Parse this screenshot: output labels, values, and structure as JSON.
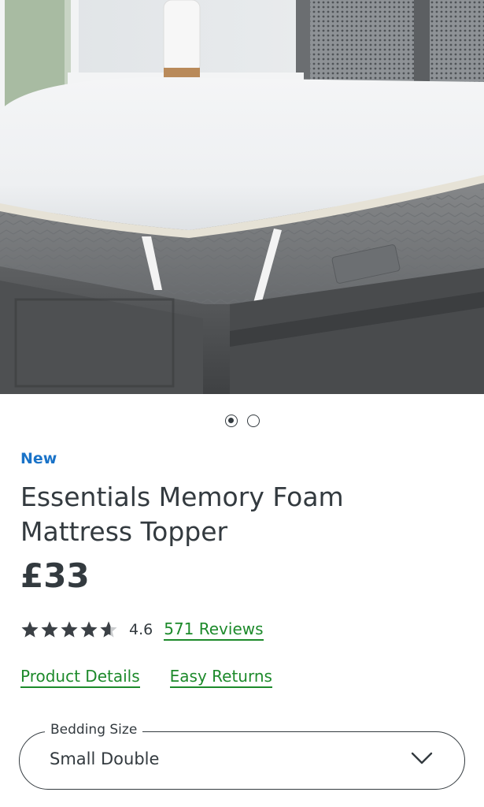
{
  "gallery": {
    "image_alt": "White mattress topper on grey mattress and dark wooden bed frame",
    "dots": [
      {
        "label": "Image 1",
        "active": true
      },
      {
        "label": "Image 2",
        "active": false
      }
    ]
  },
  "product": {
    "badge": "New",
    "title": "Essentials Memory Foam Mattress Topper",
    "price": "£33",
    "rating": {
      "value": 4.6,
      "value_text": "4.6",
      "stars_max": 5,
      "reviews_link": "571 Reviews"
    },
    "links": {
      "details": "Product Details",
      "returns": "Easy Returns"
    }
  },
  "size_select": {
    "label": "Bedding Size",
    "value": "Small Double",
    "icon": "chevron-down-icon"
  },
  "colors": {
    "text": "#333a3f",
    "new_badge": "#1a73c8",
    "link": "#1d8a2b",
    "star": "#3b4045"
  }
}
